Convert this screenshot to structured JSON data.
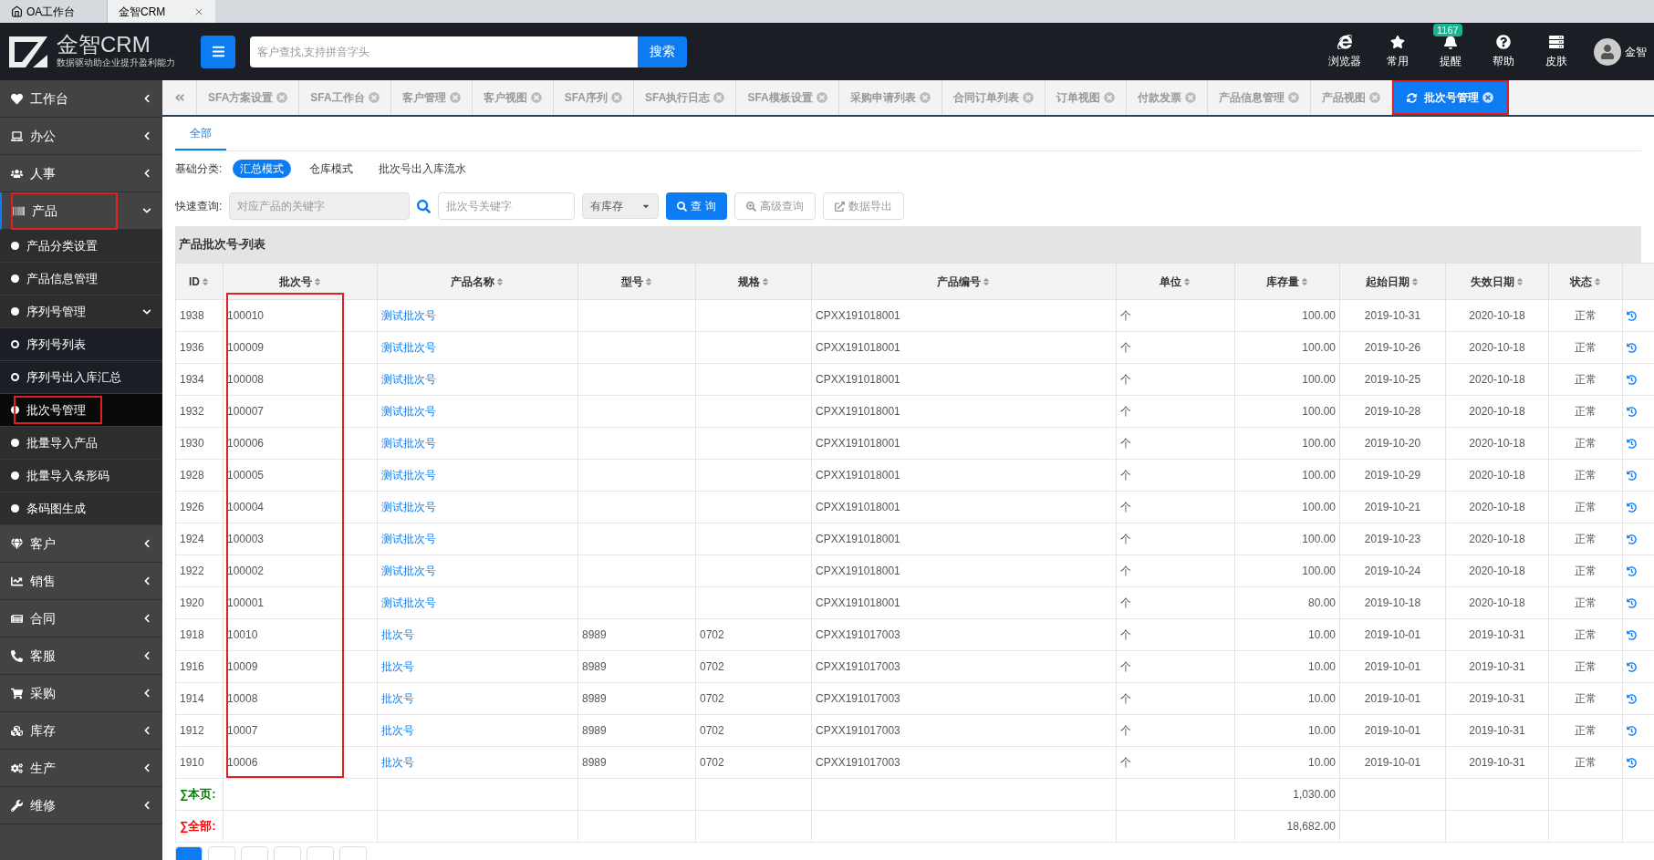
{
  "browser_tabs": [
    {
      "label": "OA工作台",
      "selected": false
    },
    {
      "label": "金智CRM",
      "selected": true
    }
  ],
  "header": {
    "logo_text": "金智CRM",
    "logo_slogan": "数据驱动助企业提升盈利能力",
    "search": {
      "placeholder": "客户查找,支持拼音字头"
    },
    "search_button": "搜索",
    "tools": [
      {
        "label": "浏览器"
      },
      {
        "label": "常用"
      },
      {
        "label": "提醒",
        "badge": "1167"
      },
      {
        "label": "帮助"
      },
      {
        "label": "皮肤"
      }
    ],
    "user": "金智"
  },
  "sidebar": {
    "items": [
      {
        "label": "工作台",
        "expanded": false,
        "selected": false,
        "highlighted": false
      },
      {
        "label": "办公",
        "expanded": false,
        "selected": false,
        "highlighted": false
      },
      {
        "label": "人事",
        "expanded": false,
        "selected": false,
        "highlighted": false
      },
      {
        "label": "产品",
        "expanded": true,
        "selected": false,
        "highlighted": true,
        "children": [
          {
            "label": "产品分类设置",
            "selected": false,
            "highlighted": false
          },
          {
            "label": "产品信息管理",
            "selected": false,
            "highlighted": false
          },
          {
            "label": "序列号管理",
            "expanded": true,
            "selected": false,
            "highlighted": false,
            "children": [
              {
                "label": "序列号列表",
                "selected": false,
                "highlighted": false
              },
              {
                "label": "序列号出入库汇总",
                "selected": false,
                "highlighted": false
              }
            ]
          },
          {
            "label": "批次号管理",
            "selected": true,
            "highlighted": true
          },
          {
            "label": "批量导入产品",
            "selected": false,
            "highlighted": false
          },
          {
            "label": "批量导入条形码",
            "selected": false,
            "highlighted": false
          },
          {
            "label": "条码图生成",
            "selected": false,
            "highlighted": false
          }
        ]
      },
      {
        "label": "客户",
        "expanded": false,
        "selected": false,
        "highlighted": false
      },
      {
        "label": "销售",
        "expanded": false,
        "selected": false,
        "highlighted": false
      },
      {
        "label": "合同",
        "expanded": false,
        "selected": false,
        "highlighted": false
      },
      {
        "label": "客服",
        "expanded": false,
        "selected": false,
        "highlighted": false
      },
      {
        "label": "采购",
        "expanded": false,
        "selected": false,
        "highlighted": false
      },
      {
        "label": "库存",
        "expanded": false,
        "selected": false,
        "highlighted": false
      },
      {
        "label": "生产",
        "expanded": false,
        "selected": false,
        "highlighted": false
      },
      {
        "label": "维修",
        "expanded": false,
        "selected": false,
        "highlighted": false
      }
    ]
  },
  "page_tabs": [
    {
      "label": "SFA方案设置",
      "selected": false,
      "highlighted": false
    },
    {
      "label": "SFA工作台",
      "selected": false,
      "highlighted": false
    },
    {
      "label": "客户管理",
      "selected": false,
      "highlighted": false
    },
    {
      "label": "客户视图",
      "selected": false,
      "highlighted": false
    },
    {
      "label": "SFA序列",
      "selected": false,
      "highlighted": false
    },
    {
      "label": "SFA执行日志",
      "selected": false,
      "highlighted": false
    },
    {
      "label": "SFA模板设置",
      "selected": false,
      "highlighted": false
    },
    {
      "label": "采购申请列表",
      "selected": false,
      "highlighted": false
    },
    {
      "label": "合同订单列表",
      "selected": false,
      "highlighted": false
    },
    {
      "label": "订单视图",
      "selected": false,
      "highlighted": false
    },
    {
      "label": "付款发票",
      "selected": false,
      "highlighted": false
    },
    {
      "label": "产品信息管理",
      "selected": false,
      "highlighted": false
    },
    {
      "label": "产品视图",
      "selected": false,
      "highlighted": false
    },
    {
      "label": "批次号管理",
      "selected": true,
      "highlighted": true
    }
  ],
  "content_tabs": [
    {
      "label": "全部",
      "selected": true
    }
  ],
  "category": {
    "label": "基础分类:",
    "options": [
      {
        "label": "汇总模式",
        "selected": true
      },
      {
        "label": "仓库模式",
        "selected": false
      },
      {
        "label": "批次号出入库流水",
        "selected": false
      }
    ]
  },
  "quick_search": {
    "label": "快速查询:",
    "product_field": {
      "placeholder": "对应产品的关键字"
    },
    "batch_field": {
      "placeholder": "批次号关键字"
    },
    "stock_select": "有库存",
    "query_button": "查 询",
    "advanced_button": "高级查询",
    "export_button": "数据导出"
  },
  "table": {
    "title": "产品批次号-列表",
    "columns": [
      {
        "label": "ID",
        "kind": "text",
        "highlighted": false
      },
      {
        "label": "批次号",
        "kind": "text",
        "highlighted": true
      },
      {
        "label": "产品名称",
        "kind": "link",
        "highlighted": false
      },
      {
        "label": "型号",
        "kind": "text",
        "highlighted": false
      },
      {
        "label": "规格",
        "kind": "text",
        "highlighted": false
      },
      {
        "label": "产品编号",
        "kind": "text",
        "highlighted": false
      },
      {
        "label": "单位",
        "kind": "text",
        "highlighted": false
      },
      {
        "label": "库存量",
        "kind": "number",
        "highlighted": false
      },
      {
        "label": "起始日期",
        "kind": "date",
        "highlighted": false
      },
      {
        "label": "失效日期",
        "kind": "date",
        "highlighted": false
      },
      {
        "label": "状态",
        "kind": "date",
        "highlighted": false
      }
    ],
    "rows": [
      [
        "1938",
        "100010",
        "测试批次号",
        "",
        "",
        "CPXX191018001",
        "个",
        "100.00",
        "2019-10-31",
        "2020-10-18",
        "正常"
      ],
      [
        "1936",
        "100009",
        "测试批次号",
        "",
        "",
        "CPXX191018001",
        "个",
        "100.00",
        "2019-10-26",
        "2020-10-18",
        "正常"
      ],
      [
        "1934",
        "100008",
        "测试批次号",
        "",
        "",
        "CPXX191018001",
        "个",
        "100.00",
        "2019-10-25",
        "2020-10-18",
        "正常"
      ],
      [
        "1932",
        "100007",
        "测试批次号",
        "",
        "",
        "CPXX191018001",
        "个",
        "100.00",
        "2019-10-28",
        "2020-10-18",
        "正常"
      ],
      [
        "1930",
        "100006",
        "测试批次号",
        "",
        "",
        "CPXX191018001",
        "个",
        "100.00",
        "2019-10-20",
        "2020-10-18",
        "正常"
      ],
      [
        "1928",
        "100005",
        "测试批次号",
        "",
        "",
        "CPXX191018001",
        "个",
        "100.00",
        "2019-10-29",
        "2020-10-18",
        "正常"
      ],
      [
        "1926",
        "100004",
        "测试批次号",
        "",
        "",
        "CPXX191018001",
        "个",
        "100.00",
        "2019-10-21",
        "2020-10-18",
        "正常"
      ],
      [
        "1924",
        "100003",
        "测试批次号",
        "",
        "",
        "CPXX191018001",
        "个",
        "100.00",
        "2019-10-23",
        "2020-10-18",
        "正常"
      ],
      [
        "1922",
        "100002",
        "测试批次号",
        "",
        "",
        "CPXX191018001",
        "个",
        "100.00",
        "2019-10-24",
        "2020-10-18",
        "正常"
      ],
      [
        "1920",
        "100001",
        "测试批次号",
        "",
        "",
        "CPXX191018001",
        "个",
        "80.00",
        "2019-10-18",
        "2020-10-18",
        "正常"
      ],
      [
        "1918",
        "10010",
        "批次号",
        "8989",
        "0702",
        "CPXX191017003",
        "个",
        "10.00",
        "2019-10-01",
        "2019-10-31",
        "正常"
      ],
      [
        "1916",
        "10009",
        "批次号",
        "8989",
        "0702",
        "CPXX191017003",
        "个",
        "10.00",
        "2019-10-01",
        "2019-10-31",
        "正常"
      ],
      [
        "1914",
        "10008",
        "批次号",
        "8989",
        "0702",
        "CPXX191017003",
        "个",
        "10.00",
        "2019-10-01",
        "2019-10-31",
        "正常"
      ],
      [
        "1912",
        "10007",
        "批次号",
        "8989",
        "0702",
        "CPXX191017003",
        "个",
        "10.00",
        "2019-10-01",
        "2019-10-31",
        "正常"
      ],
      [
        "1910",
        "10006",
        "批次号",
        "8989",
        "0702",
        "CPXX191017003",
        "个",
        "10.00",
        "2019-10-01",
        "2019-10-31",
        "正常"
      ]
    ],
    "totals": [
      {
        "label": "∑本页:",
        "value": "1,030.00",
        "color": "#008000"
      },
      {
        "label": "∑全部:",
        "value": "18,682.00",
        "color": "#ff0000"
      }
    ]
  }
}
